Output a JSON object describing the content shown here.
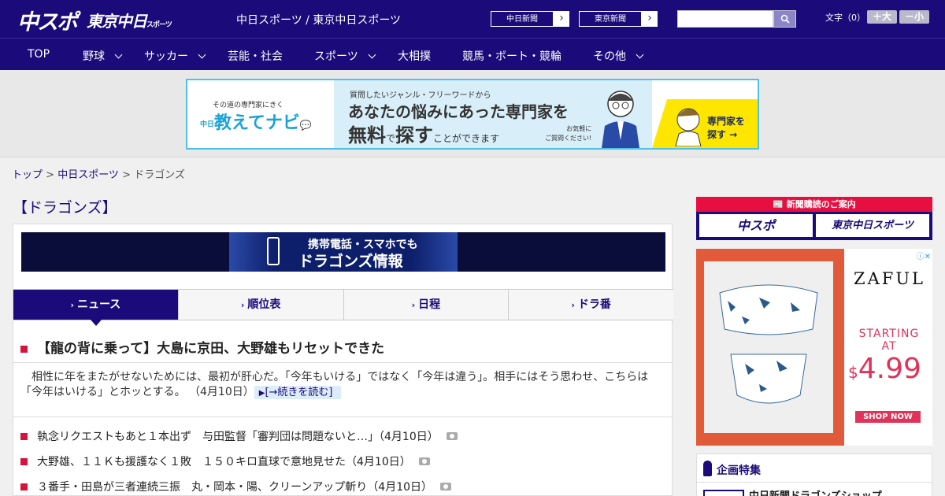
{
  "header": {
    "logo_chuspo": "中スポ",
    "logo_tokyo": "東京中日",
    "logo_tokyo_sub": "スポーツ",
    "site_title": "中日スポーツ / 東京中日スポーツ",
    "paper_links": [
      "中日新聞",
      "東京新聞"
    ],
    "search_placeholder": "",
    "font_label": "文字（0）",
    "font_bigger": "＋大",
    "font_smaller": "－小"
  },
  "nav": {
    "items": [
      {
        "label": "TOP",
        "has_dropdown": false
      },
      {
        "label": "野球",
        "has_dropdown": true
      },
      {
        "label": "サッカー",
        "has_dropdown": true
      },
      {
        "label": "芸能・社会",
        "has_dropdown": false
      },
      {
        "label": "スポーツ",
        "has_dropdown": true
      },
      {
        "label": "大相撲",
        "has_dropdown": false
      },
      {
        "label": "競馬・ボート・競輪",
        "has_dropdown": false
      },
      {
        "label": "その他",
        "has_dropdown": true
      }
    ]
  },
  "top_ad": {
    "tagline": "その道の専門家にきく",
    "brand_prefix": "中日",
    "brand": "教えてナビ",
    "line1": "質問したいジャンル・フリーワードから",
    "line2": "あなたの悩みにあった専門家を",
    "line3_a": "無料",
    "line3_b": "で",
    "line3_c": "探す",
    "line3_d": "ことができます",
    "note1": "お気軽に",
    "note2": "ご質問ください!",
    "cta1": "専門家を",
    "cta2": "探す →"
  },
  "breadcrumb": {
    "home": "トップ",
    "section": "中日スポーツ",
    "current": "ドラゴンズ",
    "sep": " > "
  },
  "main": {
    "section_title": "【ドラゴンズ】",
    "mobile_banner": {
      "line1": "携帯電話・スマホでも",
      "line2": "ドラゴンズ情報"
    },
    "tabs": [
      {
        "label": "ニュース",
        "active": true
      },
      {
        "label": "順位表",
        "active": false
      },
      {
        "label": "日程",
        "active": false
      },
      {
        "label": "ドラ番",
        "active": false
      }
    ],
    "headline": "【龍の背に乗って】大島に京田、大野雄もリセットできた",
    "lead": "相性に年をまたがせないためには、最初が肝心だ。「今年もいける」ではなく「今年は違う」。相手にはそう思わせ、こちらは「今年はいける」とホッとする。 （4月10日）",
    "read_more": "[→続きを読む]",
    "news": [
      "執念リクエストもあと１本出ず　与田監督「審判団は問題ないと…」（4月10日）",
      "大野雄、１１Ｋも援護なく１敗　１５０キロ直球で意地見せた（4月10日）",
      "３番手・田島が三者連続三振　丸・岡本・陽、クリーンアップ斬り（4月10日）"
    ]
  },
  "sidebar": {
    "subscribe_head": "新聞購読のご案内",
    "sub_buttons": [
      "中スポ",
      "東京中日スポーツ"
    ],
    "ad": {
      "brand": "ZAFUL",
      "starting": "STARTING AT",
      "price_currency": "$",
      "price": "4.99",
      "cta": "SHOP NOW"
    },
    "feature_title": "企画特集",
    "feature_item": "中日新聞ドラゴンズショップ"
  },
  "colors": {
    "brand_navy": "#1a0a7a",
    "accent_red": "#d5133d",
    "ad_cyan": "#4ec1e6"
  }
}
